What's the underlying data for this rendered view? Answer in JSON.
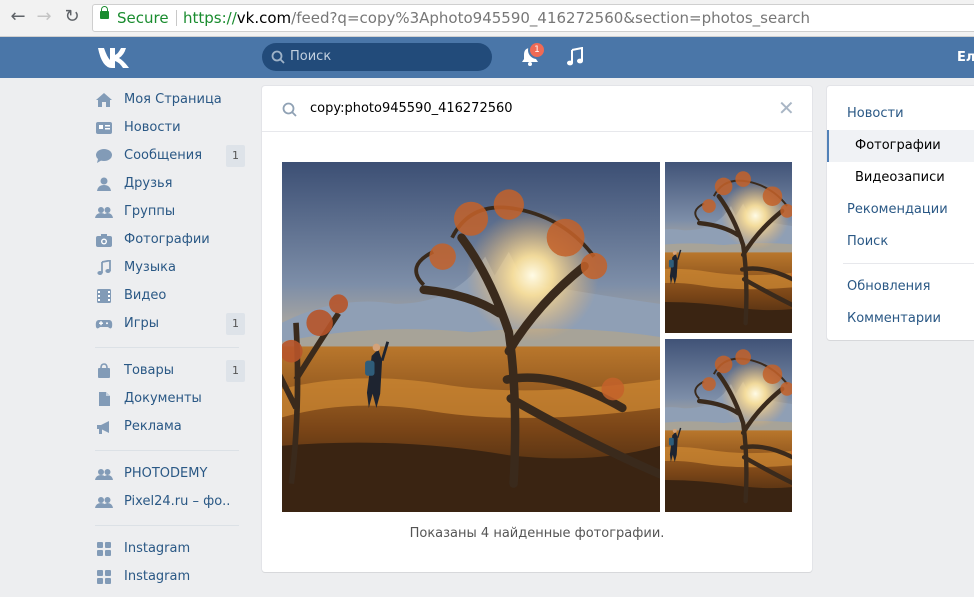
{
  "browser": {
    "secure_label": "Secure",
    "url_scheme": "https://",
    "url_host": "vk.com",
    "url_path": "/feed?q=copy%3Aphoto945590_416272560&section=photos_search"
  },
  "header": {
    "search_placeholder": "Поиск",
    "notifications_count": "1",
    "user_name_fragment": "Ел"
  },
  "left_nav": {
    "items": [
      {
        "label": "Моя Страница",
        "icon": "home-icon"
      },
      {
        "label": "Новости",
        "icon": "news-icon"
      },
      {
        "label": "Сообщения",
        "icon": "messages-icon",
        "count": "1"
      },
      {
        "label": "Друзья",
        "icon": "friends-icon"
      },
      {
        "label": "Группы",
        "icon": "groups-icon"
      },
      {
        "label": "Фотографии",
        "icon": "camera-icon"
      },
      {
        "label": "Музыка",
        "icon": "music-icon"
      },
      {
        "label": "Видео",
        "icon": "video-icon"
      },
      {
        "label": "Игры",
        "icon": "games-icon",
        "count": "1"
      }
    ],
    "items2": [
      {
        "label": "Товары",
        "icon": "shopping-bag-icon",
        "count": "1"
      },
      {
        "label": "Документы",
        "icon": "document-icon"
      },
      {
        "label": "Реклама",
        "icon": "megaphone-icon"
      }
    ],
    "communities": [
      {
        "label": "PHOTODEMY",
        "icon": "community-icon"
      },
      {
        "label": "Pixel24.ru – фо..",
        "icon": "community-icon"
      }
    ],
    "apps": [
      {
        "label": "Instagram",
        "icon": "apps-grid-icon"
      },
      {
        "label": "Instagram",
        "icon": "apps-grid-icon"
      }
    ]
  },
  "main": {
    "query": "copy:photo945590_416272560",
    "found_text": "Показаны 4 найденные фотографии."
  },
  "right_menu": {
    "items": [
      {
        "label": "Новости"
      },
      {
        "label": "Фотографии"
      },
      {
        "label": "Видеозаписи"
      },
      {
        "label": "Рекомендации"
      },
      {
        "label": "Поиск"
      },
      {
        "label": "Обновления"
      },
      {
        "label": "Комментарии"
      }
    ]
  },
  "colors": {
    "header_bg": "#4a76a8",
    "link": "#2a5885",
    "page_bg": "#edeef0",
    "badge": "#ef6a55",
    "secure_green": "#1a8c2f"
  }
}
